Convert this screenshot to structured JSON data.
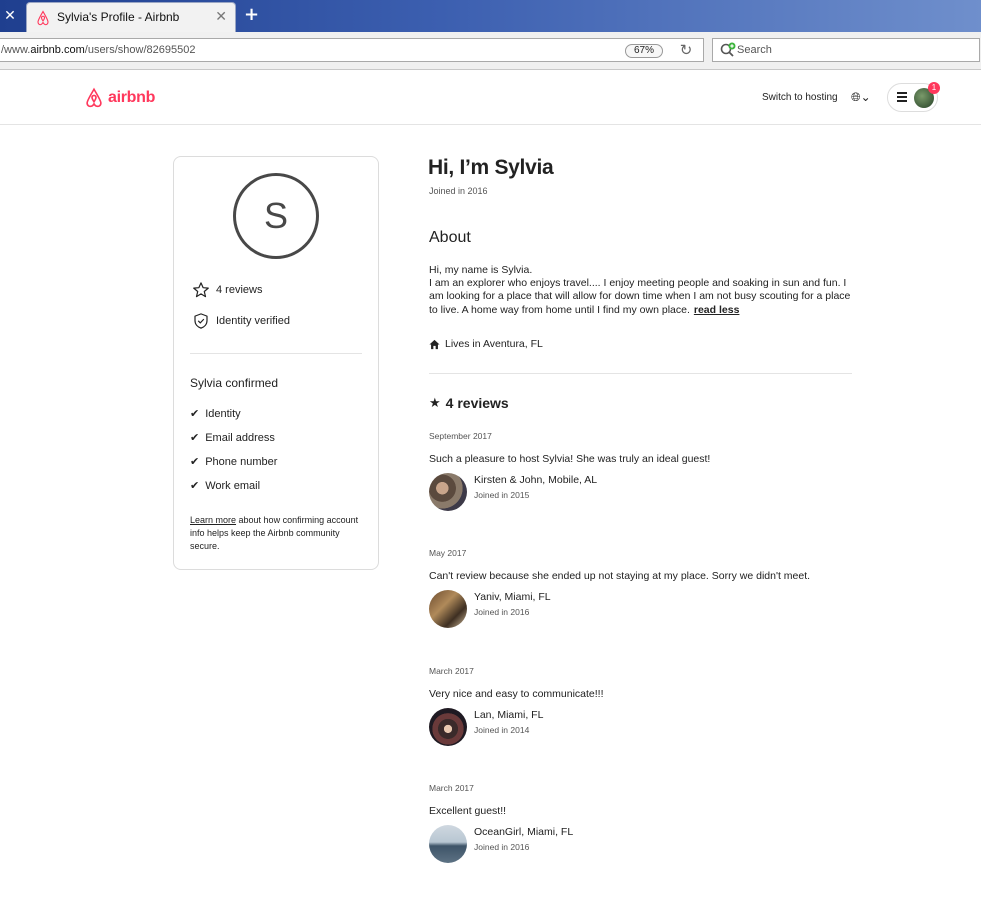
{
  "browser": {
    "tab_title": "Sylvia's Profile - Airbnb",
    "url_prefix": "/www.",
    "url_host": "airbnb.com",
    "url_path": "/users/show/82695502",
    "zoom": "67%",
    "search_placeholder": "Search"
  },
  "header": {
    "logo_text": "airbnb",
    "switch_hosting": "Switch to hosting",
    "notification_count": "1",
    "brand_color": "#ff385c"
  },
  "profile_card": {
    "avatar_letter": "S",
    "reviews": "4 reviews",
    "identity_verified": "Identity verified",
    "confirmed_title": "Sylvia confirmed",
    "confirmed_items": [
      "Identity",
      "Email address",
      "Phone number",
      "Work email"
    ],
    "learn_more": "Learn more",
    "learn_text": " about how confirming account info helps keep the Airbnb community secure."
  },
  "main": {
    "title": "Hi, I’m Sylvia",
    "joined": "Joined in 2016",
    "about_heading": "About",
    "about_line1": "Hi, my name is Sylvia.",
    "about_line2": "I am an explorer who enjoys travel.... I enjoy meeting people and soaking in sun and fun. I am looking for a place that will allow for down time when I am not busy scouting for a place to live. A home way from home until I find my own place.",
    "read_less": "read less",
    "lives_in": "Lives in Aventura, FL",
    "reviews_heading": "4 reviews"
  },
  "reviews": [
    {
      "date": "September 2017",
      "text": "Such a pleasure to host Sylvia! She was truly an ideal guest!",
      "author": "Kirsten & John, Mobile, AL",
      "joined": "Joined in 2015"
    },
    {
      "date": "May 2017",
      "text": "Can't review because she ended up not staying at my place. Sorry we didn't meet.",
      "author": "Yaniv, Miami, FL",
      "joined": "Joined in 2016"
    },
    {
      "date": "March 2017",
      "text": "Very nice and easy to communicate!!!",
      "author": "Lan, Miami, FL",
      "joined": "Joined in 2014"
    },
    {
      "date": "March 2017",
      "text": "Excellent guest!!",
      "author": "OceanGirl, Miami, FL",
      "joined": "Joined in 2016"
    }
  ]
}
